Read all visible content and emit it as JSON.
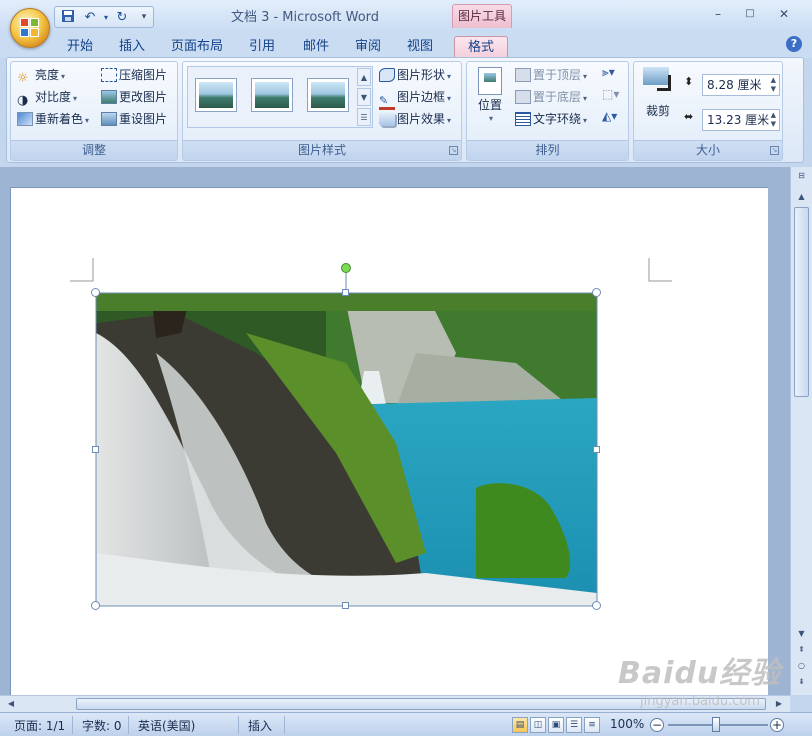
{
  "window": {
    "title": "文档 3 - Microsoft Word",
    "context_tool_tab": "图片工具",
    "controls": {
      "minimize": "–",
      "maximize": "□",
      "close": "✕"
    }
  },
  "quick_access": {
    "save": "save-icon",
    "undo": "undo-icon",
    "redo": "redo-icon",
    "customize": "▾"
  },
  "tabs": [
    "开始",
    "插入",
    "页面布局",
    "引用",
    "邮件",
    "审阅",
    "视图",
    "格式"
  ],
  "active_tab": "格式",
  "help": "?",
  "ribbon": {
    "adjust": {
      "label": "调整",
      "brightness": "亮度",
      "contrast": "对比度",
      "recolor": "重新着色",
      "compress": "压缩图片",
      "change_picture": "更改图片",
      "reset_picture": "重设图片"
    },
    "picture_styles": {
      "label": "图片样式",
      "shape": "图片形状",
      "border": "图片边框",
      "effects": "图片效果"
    },
    "arrange": {
      "label": "排列",
      "position": "位置",
      "bring_to_front": "置于顶层",
      "send_to_back": "置于底层",
      "text_wrapping": "文字环绕"
    },
    "size": {
      "label": "大小",
      "crop": "裁剪",
      "height": "8.28 厘米",
      "width": "13.23 厘米"
    }
  },
  "status_bar": {
    "page": "页面: 1/1",
    "words": "字数: 0",
    "language": "英语(美国)",
    "mode": "插入",
    "zoom": "100%"
  },
  "watermark": {
    "logo": "Baidu经验",
    "url": "jingyan.baidu.com"
  },
  "colors": {
    "accent": "#15428b",
    "context_tab": "#eebfd0",
    "ribbon": "#dbe7f6"
  }
}
